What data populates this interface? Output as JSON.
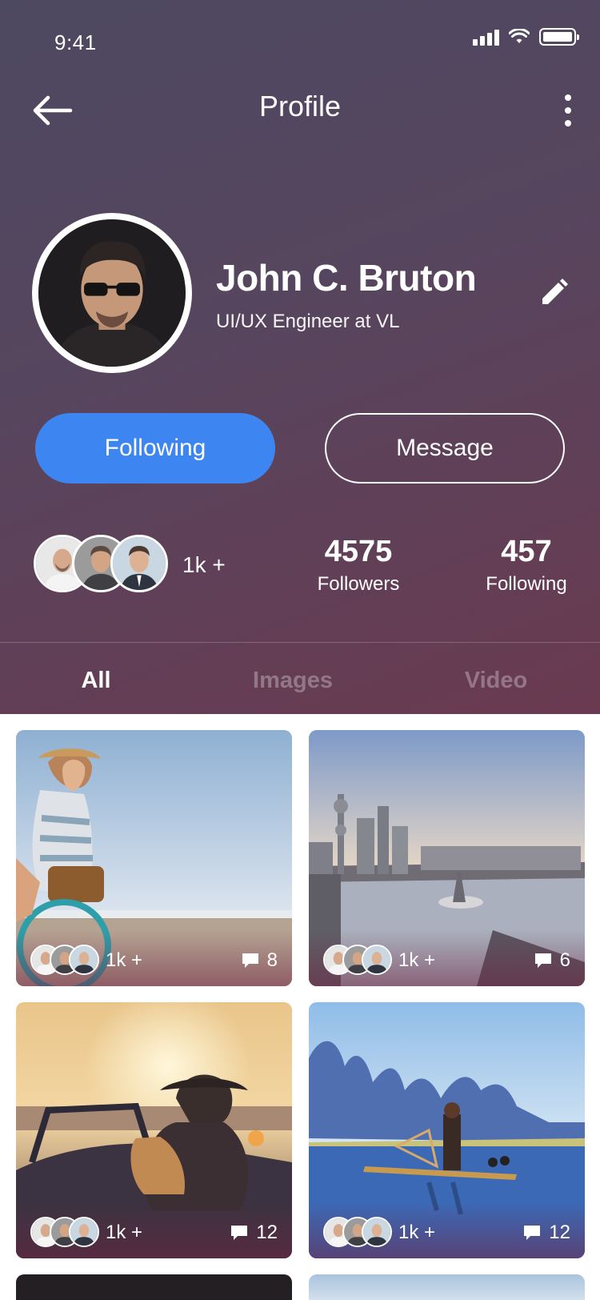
{
  "status_bar": {
    "time": "9:41"
  },
  "nav": {
    "title": "Profile"
  },
  "profile": {
    "name": "John C. Bruton",
    "job": "UI/UX Engineer at VL"
  },
  "actions": {
    "following_label": "Following",
    "message_label": "Message"
  },
  "stats": {
    "mutual_count": "1k +",
    "followers_value": "4575",
    "followers_label": "Followers",
    "following_value": "457",
    "following_label": "Following"
  },
  "tabs": [
    {
      "label": "All",
      "active": true
    },
    {
      "label": "Images",
      "active": false
    },
    {
      "label": "Video",
      "active": false
    }
  ],
  "posts": [
    {
      "scene": "woman-bicycle-beach",
      "likes": "1k +",
      "comments": "8"
    },
    {
      "scene": "city-skyline-river",
      "likes": "1k +",
      "comments": "6"
    },
    {
      "scene": "couple-convertible-sunset",
      "likes": "1k +",
      "comments": "12"
    },
    {
      "scene": "fisherman-raft-mountains",
      "likes": "1k +",
      "comments": "12"
    }
  ],
  "colors": {
    "accent": "#3d86f2",
    "header_top": "#4d4961",
    "header_bottom": "#6a3a50"
  }
}
